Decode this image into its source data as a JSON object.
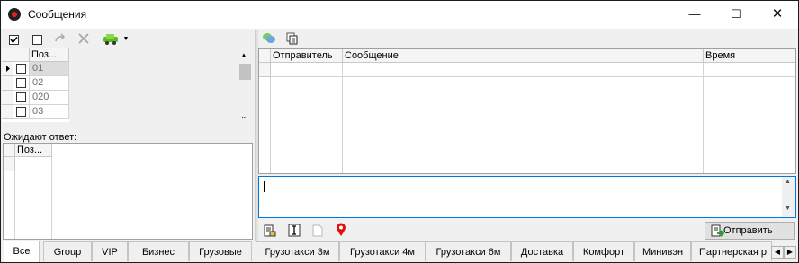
{
  "window": {
    "title": "Сообщения"
  },
  "window_controls": {
    "minimize": "—",
    "maximize": "☐",
    "close": "✕"
  },
  "left": {
    "columns": {
      "poz": "Поз..."
    },
    "rows": [
      {
        "value": "01",
        "current": true
      },
      {
        "value": "02"
      },
      {
        "value": "020"
      },
      {
        "value": "03"
      }
    ],
    "waiting_label": "Ожидают ответ:",
    "waiting_columns": {
      "poz": "Поз..."
    }
  },
  "right": {
    "columns": {
      "sender": "Отправитель",
      "message": "Сообщение",
      "time": "Время"
    },
    "message_input": {
      "value": ""
    },
    "send_label": "Отправить"
  },
  "tabs": [
    {
      "label": "Все",
      "active": true
    },
    {
      "label": "Group"
    },
    {
      "label": "VIP"
    },
    {
      "label": "Бизнес"
    },
    {
      "label": "Грузовые"
    },
    {
      "label": "Грузотакси 3м"
    },
    {
      "label": "Грузотакси 4м"
    },
    {
      "label": "Грузотакси 6м"
    },
    {
      "label": "Доставка"
    },
    {
      "label": "Комфорт"
    },
    {
      "label": "Минивэн"
    },
    {
      "label": "Партнерская р"
    }
  ],
  "tab_scroll": {
    "left": "◀",
    "right": "▶"
  },
  "colors": {
    "accent": "#0078d7",
    "pin": "#e01010",
    "car": "#5fb820"
  }
}
